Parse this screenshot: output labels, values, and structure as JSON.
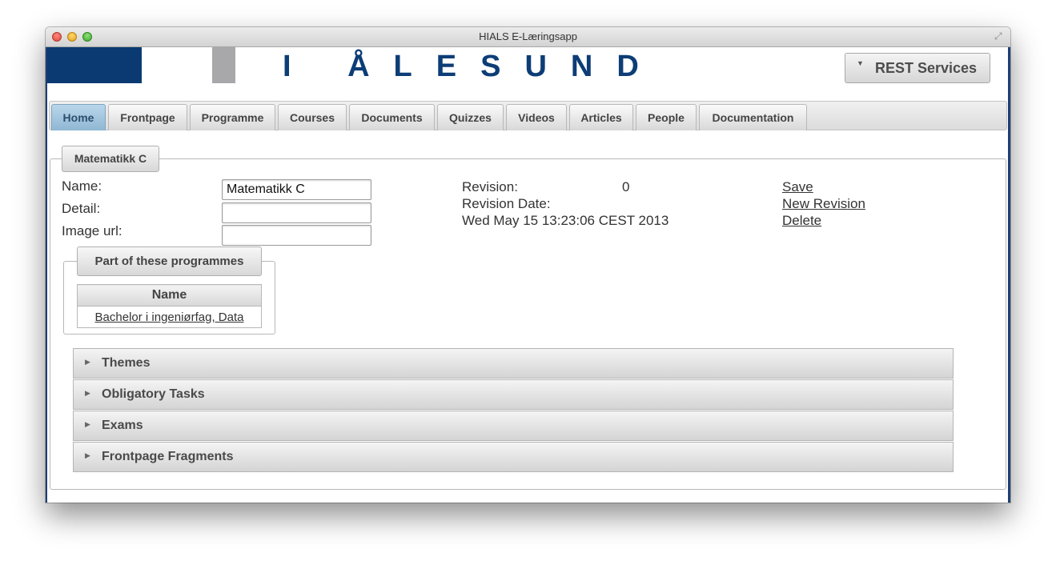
{
  "window": {
    "title": "HIALS E-Læringsapp"
  },
  "banner": {
    "logo_text": "I ÅLESUND",
    "rest_button": "REST Services"
  },
  "tabs": [
    "Home",
    "Frontpage",
    "Programme",
    "Courses",
    "Documents",
    "Quizzes",
    "Videos",
    "Articles",
    "People",
    "Documentation"
  ],
  "course": {
    "legend": "Matematikk C",
    "name_label": "Name:",
    "name_value": "Matematikk C",
    "detail_label": "Detail:",
    "detail_value": "",
    "image_label": "Image url:",
    "image_value": ""
  },
  "revision": {
    "revision_label": "Revision:",
    "revision_value": "0",
    "date_label": "Revision Date:",
    "date_value": "Wed May 15 13:23:06 CEST 2013"
  },
  "actions": {
    "save": "Save",
    "new_revision": "New Revision",
    "delete": "Delete"
  },
  "programmes": {
    "legend": "Part of these programmes",
    "column": "Name",
    "rows": [
      "Bachelor i ingeniørfag, Data"
    ]
  },
  "sections": [
    "Themes",
    "Obligatory Tasks",
    "Exams",
    "Frontpage Fragments"
  ],
  "colors": {
    "brand_blue": "#0b3a72",
    "active_tab": "#a3c6df"
  }
}
